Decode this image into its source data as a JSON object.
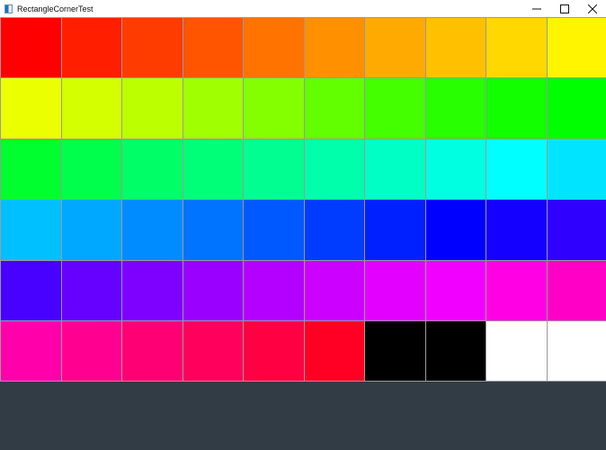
{
  "window": {
    "title": "RectangleCornerTest",
    "app_icon": "window-app-icon",
    "controls": [
      {
        "name": "minimize-button",
        "icon": "minimize-icon"
      },
      {
        "name": "maximize-button",
        "icon": "maximize-icon"
      },
      {
        "name": "close-button",
        "icon": "close-icon"
      }
    ]
  },
  "canvas": {
    "background": "#323c44",
    "cell_border": "#9a9a9a",
    "rows": [
      [
        "#ff0000",
        "#ff1e00",
        "#ff3c00",
        "#ff5500",
        "#ff7300",
        "#ff9100",
        "#ffaa00",
        "#ffc000",
        "#ffd800",
        "#fff500"
      ],
      [
        "#ecff00",
        "#d4ff00",
        "#bcff00",
        "#a0ff00",
        "#84ff00",
        "#62ff00",
        "#44ff00",
        "#28ff00",
        "#12ff00",
        "#00ff00"
      ],
      [
        "#00ff2e",
        "#00ff4c",
        "#00ff66",
        "#00ff78",
        "#00ff90",
        "#00ffaa",
        "#00ffc4",
        "#00ffe0",
        "#00ffff",
        "#00e4ff"
      ],
      [
        "#00c0ff",
        "#00a8ff",
        "#008cff",
        "#0074ff",
        "#0058ff",
        "#003cff",
        "#0020ff",
        "#0000ff",
        "#1400ff",
        "#3000ff"
      ],
      [
        "#4800ff",
        "#6600ff",
        "#7e00ff",
        "#9a00ff",
        "#b400ff",
        "#cc00ff",
        "#e400ff",
        "#f200ff",
        "#ff00e4",
        "#ff00c6"
      ],
      [
        "#ff00aa",
        "#ff0090",
        "#ff0074",
        "#ff005c",
        "#ff0042",
        "#ff0024",
        "#000000",
        "#000000",
        "#ffffff",
        "#ffffff"
      ]
    ]
  }
}
